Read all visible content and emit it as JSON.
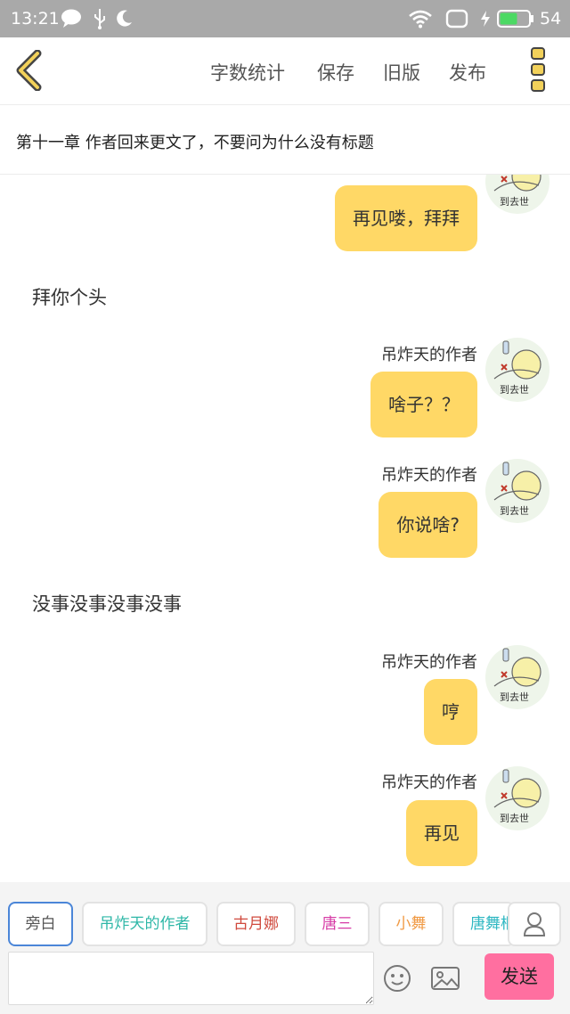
{
  "status_bar": {
    "time": "13:21",
    "battery": "54",
    "icons": [
      "chat-bubble-icon",
      "usb-icon",
      "moon-icon",
      "wifi-icon",
      "sim-icon",
      "charging-icon",
      "battery-icon"
    ]
  },
  "app_bar": {
    "back_icon": "chevron-left-icon",
    "actions": [
      "字数统计",
      "保存",
      "旧版",
      "发布"
    ],
    "more_icon": "more-dots-icon",
    "accent_color": "#e6b800"
  },
  "chapter": {
    "title": "第十一章   作者回来更文了，不要问为什么没有标题"
  },
  "chat": {
    "messages": [
      {
        "type": "author",
        "speaker": "",
        "text": "再见喽，拜拜"
      },
      {
        "type": "narration",
        "text": "拜你个头"
      },
      {
        "type": "author",
        "speaker": "吊炸天的作者",
        "text": "啥子？？"
      },
      {
        "type": "author",
        "speaker": "吊炸天的作者",
        "text": "你说啥?"
      },
      {
        "type": "narration",
        "text": "没事没事没事没事"
      },
      {
        "type": "author",
        "speaker": "吊炸天的作者",
        "text": "哼"
      },
      {
        "type": "author",
        "speaker": "吊炸天的作者",
        "text": "再见"
      }
    ],
    "avatar_caption": "到去世",
    "bubble_color": "#ffd866"
  },
  "roles": [
    {
      "label": "旁白",
      "color": "#555555",
      "selected": true
    },
    {
      "label": "吊炸天的作者",
      "color": "#2eb7a7",
      "selected": false
    },
    {
      "label": "古月娜",
      "color": "#d04a3e",
      "selected": false
    },
    {
      "label": "唐三",
      "color": "#d63aa5",
      "selected": false
    },
    {
      "label": "小舞",
      "color": "#f09a44",
      "selected": false
    },
    {
      "label": "唐舞桐",
      "color": "#2eb7c2",
      "selected": false
    }
  ],
  "composer": {
    "input_value": "",
    "send_label": "发送",
    "send_color": "#ff6fa0"
  }
}
